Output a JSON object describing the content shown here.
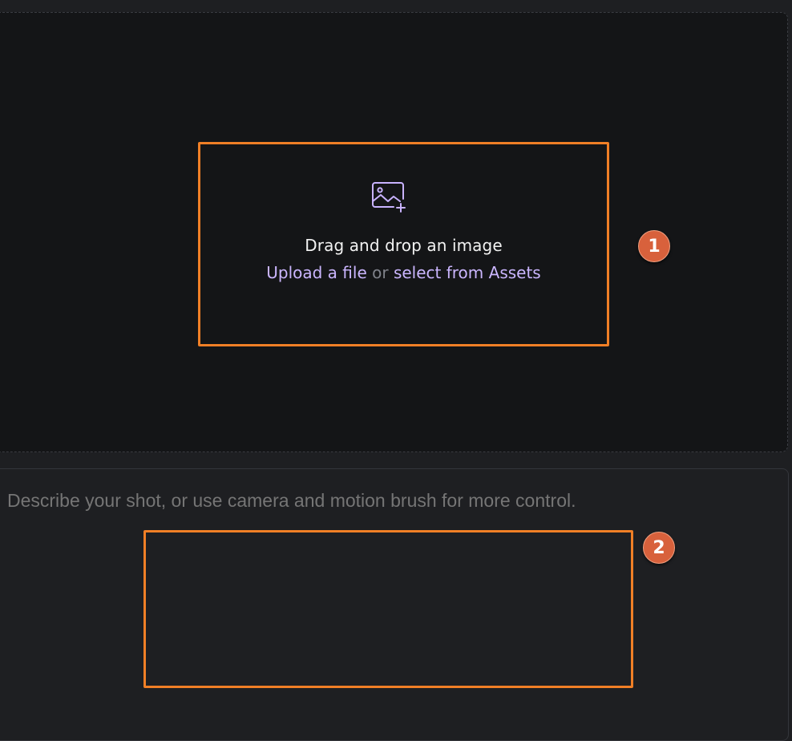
{
  "upload": {
    "title": "Drag and drop an image",
    "upload_link": "Upload a file",
    "or_text": "or",
    "assets_link": "select from Assets",
    "icon": "image-plus-icon"
  },
  "prompt": {
    "placeholder": "Describe your shot, or use camera and motion brush for more control."
  },
  "annotations": [
    {
      "label": "1"
    },
    {
      "label": "2"
    }
  ],
  "colors": {
    "highlight": "#f07f26",
    "badge": "#d8613c",
    "link": "#cbb6ff"
  }
}
